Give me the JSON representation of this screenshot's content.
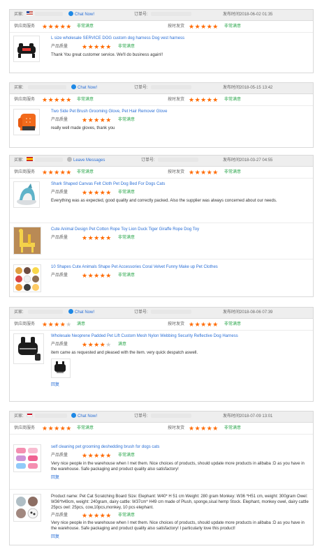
{
  "labels": {
    "buyer": "买家:",
    "order_no": "订单号:",
    "time_prefix": "发布时间:",
    "supplier_service": "供应商服务",
    "ship_on_time": "按时发货",
    "product_quality": "产品质量",
    "very_satisfied": "非常满意",
    "satisfied": "满意",
    "reply": "回复"
  },
  "reviews": [
    {
      "flag": "us",
      "chat_label": "Chat Now!",
      "date": "2018-06-02 01:35",
      "supplier_stars": 5,
      "supplier_tag": "非常满意",
      "ship_stars": 5,
      "ship_tag": "非常满意",
      "products": [
        {
          "title": "L size wholesale SERVICE DOG custom dog harness Dog vest harness",
          "stars": 5,
          "tag": "非常满意",
          "comment": "Thank You great customer service. We'll do business again!!",
          "image": "black-dog-harness"
        }
      ]
    },
    {
      "flag": "",
      "chat_label": "Chat Now!",
      "date": "2018-05-15 13:42",
      "supplier_stars": 5,
      "supplier_tag": "非常满意",
      "ship_stars": 5,
      "ship_tag": "非常满意",
      "products": [
        {
          "title": "Two Side Pet Brush Grooming Glove, Pet Hair Remover Glove",
          "stars": 5,
          "tag": "非常满意",
          "comment": "really well made gloves, thank you",
          "image": "orange-grooming-glove"
        }
      ]
    },
    {
      "flag": "es",
      "chat_label": "Leave Messages",
      "date": "2018-03-27 04:55",
      "supplier_stars": 5,
      "supplier_tag": "非常满意",
      "ship_stars": 5,
      "ship_tag": "非常满意",
      "products": [
        {
          "title": "Shark Shaped Canvas Felt Cloth Pet Dog Bed For Dogs Cats",
          "stars": 5,
          "tag": "非常满意",
          "comment": "Everything was as expected, good quality and correctly packed. Also the supplier was always concerned about our needs.",
          "image": "shark-dog-bed"
        },
        {
          "title": "Cute Animal Design Pet Cotton Rope Toy Lion Duck Tiger Giraffe Rope Dog Toy",
          "stars": 5,
          "tag": "非常满意",
          "comment": "",
          "image": "giraffe-rope-toy"
        },
        {
          "title": "10 Shapes Cute Animals Shape Pet Accessories Coral Velvet Funny Make up Pet Clothes",
          "stars": 5,
          "tag": "非常满意",
          "comment": "",
          "image": "pet-costumes"
        }
      ]
    },
    {
      "flag": "",
      "chat_label": "Chat Now!",
      "date": "2018-08-06 07:39",
      "supplier_stars": 4,
      "supplier_tag": "满意",
      "ship_stars": 5,
      "ship_tag": "非常满意",
      "products": [
        {
          "title": "Wholesale Neoprene Padded Pet Lift Custom Mesh Nylon Webbing Security Reflective Dog Harness",
          "stars": 4,
          "tag": "满意",
          "comment": "item came as requested and pleased with the item. very quick despatch aswell.",
          "image": "black-lift-harness"
        }
      ]
    },
    {
      "flag": "id",
      "chat_label": "Chat Now!",
      "date": "2018-07-09 13:01",
      "supplier_stars": 5,
      "supplier_tag": "非常满意",
      "ship_stars": 5,
      "ship_tag": "非常满意",
      "products": [
        {
          "title": "self cleaning pet grooming deshedding brush for dogs cats",
          "stars": 5,
          "tag": "非常满意",
          "comment": "Very nice people in the warehouse when I met them. Nice choices of products, should update more products in alibaba :D as you have in the warehouse. Safe packaging and product quality also satisfactory!",
          "image": "pink-grooming-brushes"
        },
        {
          "title": "Product name: Pet Cat Scratching Board Size: Elephant: W40* H 51 cm Weight: 280 gram Monkey: W36 *H51 cm, weight: 300gram Owel: W36*h49cm, weight: 240gram, dairy cattle: W37cm* H49 cm made of Plush, sponge,sisal hemp Stock. Elephant, monkey owel, dairy cattle 25pcs owl: 25pcs, cow,10pcs,monkey, 10 pcs elephant.",
          "stars": 5,
          "tag": "非常满意",
          "comment": "Very nice people in the warehouse when I met them. Nice choices of products, should update more products in alibaba :D as you have in the warehouse. Safe packaging and product quality also satisfactory! I particularly love this product!",
          "image": "animal-scratching-boards"
        }
      ]
    }
  ]
}
